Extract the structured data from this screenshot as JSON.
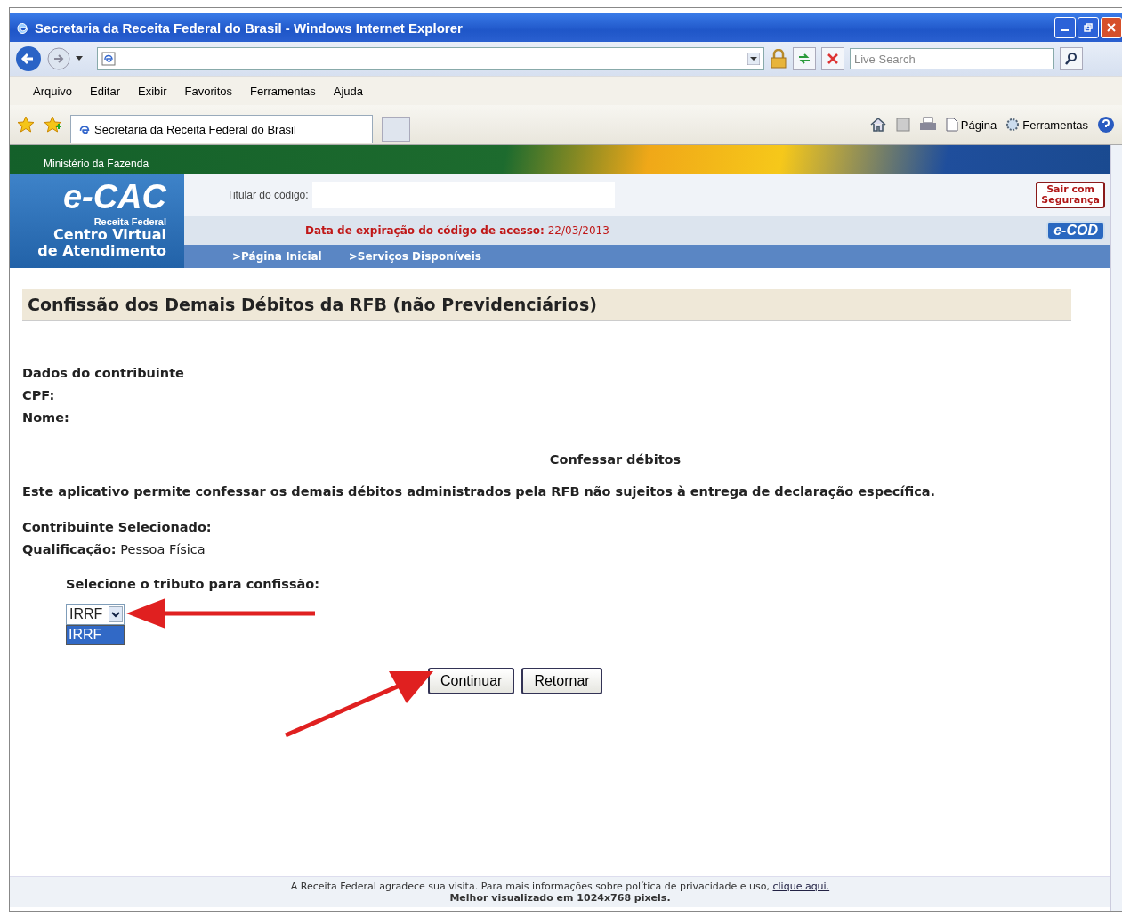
{
  "window": {
    "title": "Secretaria da Receita Federal do Brasil - Windows Internet Explorer"
  },
  "search": {
    "placeholder": "Live Search"
  },
  "menu": [
    "Arquivo",
    "Editar",
    "Exibir",
    "Favoritos",
    "Ferramentas",
    "Ajuda"
  ],
  "tabs": [
    {
      "label": "Secretaria da Receita Federal do Brasil",
      "selected": true
    }
  ],
  "command_bar": [
    "Página",
    "Ferramentas"
  ],
  "site_header": {
    "ministry": "Ministério da Fazenda",
    "logo": "e-CAC",
    "logo_subtitle": "Receita Federal",
    "logo_tagline": [
      "Centro Virtual",
      "de Atendimento"
    ],
    "holder_label": "Titular do código:",
    "logout_button": [
      "Sair com",
      "Segurança"
    ],
    "expiry": "**Data de expiração do código de acesso:** 22/03/2013",
    "ecod_badge": "e-COD",
    "nav_links": [
      ">Página Inicial",
      ">Serviços Disponíveis"
    ]
  },
  "page_title": "Confissão dos Demais Débitos da RFB (não Previdenciários)",
  "taxpayer": {
    "heading": "Dados do contribuinte",
    "fields": [
      {
        "label": "CPF:"
      },
      {
        "label": "Nome:"
      }
    ]
  },
  "section_title": "Confessar débitos",
  "description": "Este aplicativo permite confessar os demais débitos administrados pela RFB não sujeitos à entrega de declaração específica.",
  "selected_taxpayer": {
    "label": "Contribuinte Selecionado:"
  },
  "qualification": {
    "label": "Qualificação:",
    "value": "Pessoa Física"
  },
  "tax_select": {
    "label": "Selecione o tributo para confissão:",
    "value": "IRRF",
    "expanded": true,
    "options": [
      {
        "label": "IRRF",
        "selected": true
      }
    ]
  },
  "buttons": [
    "Continuar",
    "Retornar"
  ],
  "footer": {
    "text": "A Receita Federal agradece sua visita. Para mais informações sobre política de privacidade e uso,",
    "link": "clique aqui.",
    "note": "Melhor visualizado em 1024x768 pixels."
  }
}
